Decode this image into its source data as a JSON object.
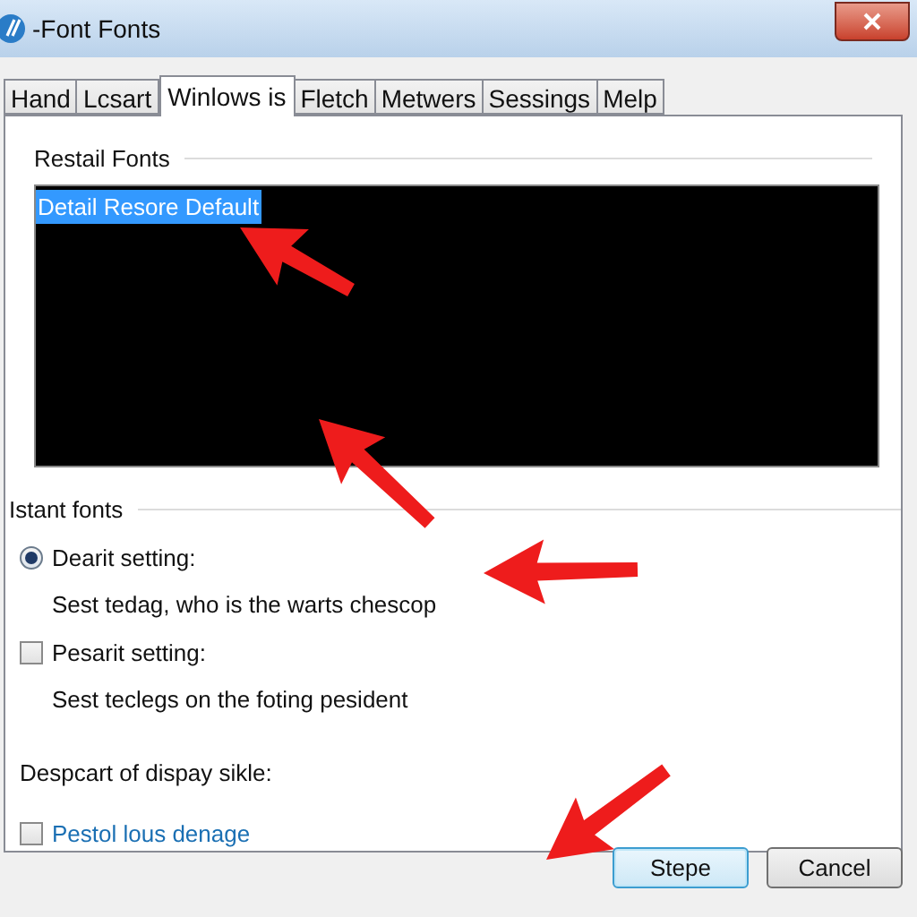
{
  "window": {
    "title": "-Font Fonts"
  },
  "tabs": [
    {
      "label": "Hand",
      "selected": false
    },
    {
      "label": "Lcsart",
      "selected": false
    },
    {
      "label": "Winlows is",
      "selected": true
    },
    {
      "label": "Fletch",
      "selected": false
    },
    {
      "label": "Metwers",
      "selected": false
    },
    {
      "label": "Sessings",
      "selected": false
    },
    {
      "label": "Melp",
      "selected": false
    }
  ],
  "restail_fonts": {
    "label": "Restail Fonts",
    "items": [
      {
        "label": "Detail Resore Default",
        "selected": true
      }
    ]
  },
  "instant_fonts": {
    "label": "Istant fonts",
    "options": [
      {
        "kind": "radio",
        "label": "Dearit setting:",
        "description": "Sest tedag, who is the warts chescop",
        "checked": true
      },
      {
        "kind": "checkbox",
        "label": "Pesarit setting:",
        "description": "Sest teclegs on the foting pesident",
        "checked": false
      }
    ]
  },
  "display": {
    "label": "Despcart of dispay sikle:",
    "option": {
      "label": "Pestol lous denage",
      "checked": false
    }
  },
  "buttons": [
    {
      "label": "Stepe",
      "default": true
    },
    {
      "label": "Cancel",
      "default": false
    }
  ]
}
